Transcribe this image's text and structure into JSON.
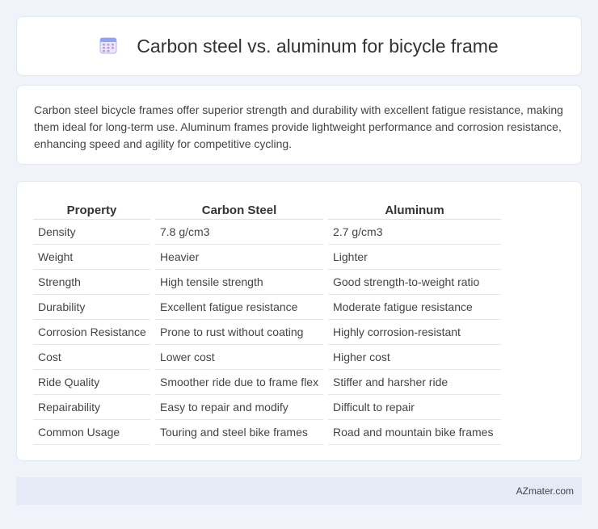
{
  "header": {
    "title": "Carbon steel vs. aluminum for bicycle frame",
    "icon": "calendar-icon"
  },
  "intro": {
    "text": "Carbon steel bicycle frames offer superior strength and durability with excellent fatigue resistance, making them ideal for long-term use. Aluminum frames provide lightweight performance and corrosion resistance, enhancing speed and agility for competitive cycling."
  },
  "table": {
    "headers": [
      "Property",
      "Carbon Steel",
      "Aluminum"
    ],
    "rows": [
      [
        "Density",
        "7.8 g/cm3",
        "2.7 g/cm3"
      ],
      [
        "Weight",
        "Heavier",
        "Lighter"
      ],
      [
        "Strength",
        "High tensile strength",
        "Good strength-to-weight ratio"
      ],
      [
        "Durability",
        "Excellent fatigue resistance",
        "Moderate fatigue resistance"
      ],
      [
        "Corrosion Resistance",
        "Prone to rust without coating",
        "Highly corrosion-resistant"
      ],
      [
        "Cost",
        "Lower cost",
        "Higher cost"
      ],
      [
        "Ride Quality",
        "Smoother ride due to frame flex",
        "Stiffer and harsher ride"
      ],
      [
        "Repairability",
        "Easy to repair and modify",
        "Difficult to repair"
      ],
      [
        "Common Usage",
        "Touring and steel bike frames",
        "Road and mountain bike frames"
      ]
    ]
  },
  "footer": {
    "brand": "AZmater.com"
  },
  "colors": {
    "background": "#f0f3f9",
    "card": "#ffffff",
    "footer": "#e5eaf6",
    "icon_accent": "#7b8ff0"
  }
}
